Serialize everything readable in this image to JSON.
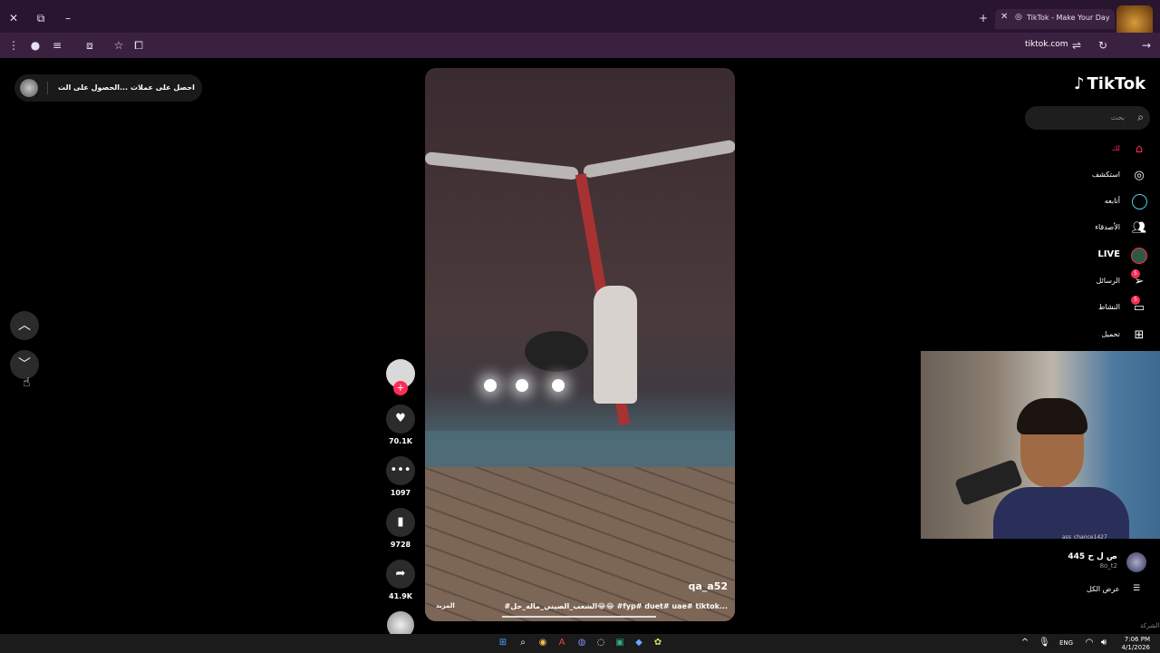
{
  "browser": {
    "tab_title": "TikTok - Make Your Day",
    "url": "tiktok.com",
    "new_tab_icon": "plus-icon",
    "close_icon": "close-icon"
  },
  "promo": {
    "item1": "الحصول على الت...",
    "item2": "احصل على عملات"
  },
  "video": {
    "author": "qa_a52",
    "caption": "#الشعب_الصيني_ماله_حل😂😂 #fyp# duet# uae# tiktok...",
    "more": "المزيد"
  },
  "actions": {
    "likes": "70.1K",
    "comments": "1097",
    "saves": "9728",
    "shares": "41.9K"
  },
  "sidebar": {
    "logo": "TikTok",
    "search_placeholder": "بحث",
    "items": [
      {
        "label": "لك",
        "icon": "home-icon"
      },
      {
        "label": "استكشف",
        "icon": "compass-icon"
      },
      {
        "label": "أتابعه",
        "icon": "following-icon"
      },
      {
        "label": "الأصدقاء",
        "icon": "friends-icon"
      },
      {
        "label": "LIVE",
        "icon": "live-icon"
      },
      {
        "label": "الرسائل",
        "icon": "messages-icon",
        "badge": "5"
      },
      {
        "label": "النشاط",
        "icon": "activity-icon",
        "badge": "5"
      },
      {
        "label": "تحميل",
        "icon": "upload-icon"
      }
    ],
    "following_account": {
      "name": "ص ل ح 445",
      "username": "8o_t2"
    },
    "see_all": "عرض الكل",
    "company": "الشركة"
  },
  "webcam": {
    "overlay_text": "ass_chance1427"
  },
  "taskbar": {
    "lang": "ENG",
    "time": "7:06 PM",
    "date": "4/1/2026"
  },
  "colors": {
    "accent": "#fe2c55",
    "browser_frame": "#2a1530"
  }
}
